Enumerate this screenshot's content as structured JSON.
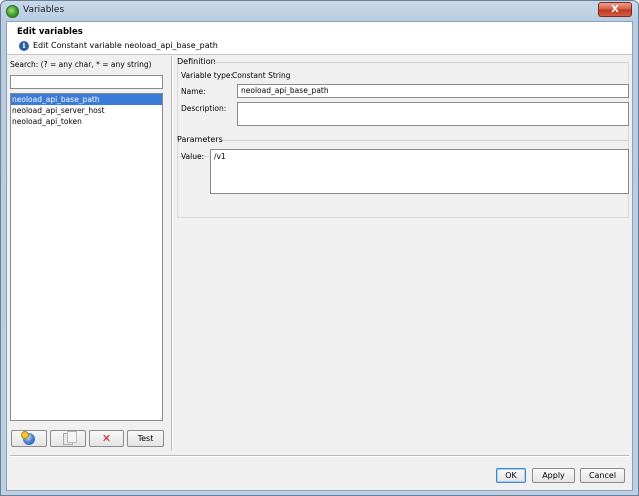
{
  "window": {
    "title": "Variables",
    "close_label": "X"
  },
  "header": {
    "title": "Edit variables",
    "info_icon": "info-icon",
    "subtitle": "Edit Constant variable neoload_api_base_path"
  },
  "left_panel": {
    "search_label": "Search: (? = any char, * = any string)",
    "search_value": "",
    "variables": [
      "neoload_api_base_path",
      "neoload_api_server_host",
      "neoload_api_token"
    ],
    "selected_index": 0,
    "buttons": {
      "new_icon": "new-variable-icon",
      "copy_icon": "copy-icon",
      "delete_icon": "delete-icon",
      "delete_glyph": "✕",
      "test_label": "Test"
    }
  },
  "definition": {
    "title": "Definition",
    "variable_type_label": "Variable type:",
    "variable_type_value": "Constant String",
    "name_label": "Name:",
    "name_value": "neoload_api_base_path",
    "description_label": "Description:",
    "description_value": ""
  },
  "parameters": {
    "title": "Parameters",
    "value_label": "Value:",
    "value": "/v1"
  },
  "dialog_buttons": {
    "ok": "OK",
    "apply": "Apply",
    "cancel": "Cancel"
  },
  "colors": {
    "selection": "#3a7ad9",
    "close_button": "#c0391f",
    "titlebar": "#c9d9ea"
  }
}
